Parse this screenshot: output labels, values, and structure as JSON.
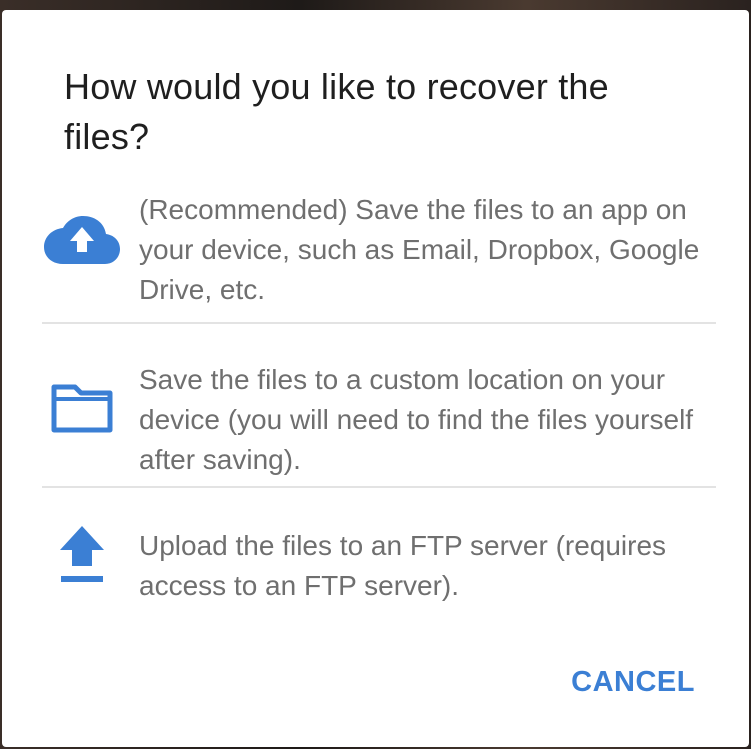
{
  "dialog": {
    "title": "How would you like to recover the files?",
    "options": [
      {
        "icon": "cloud-upload-icon",
        "label": "(Recommended) Save the files to an app on your device, such as Email, Dropbox, Google Drive, etc."
      },
      {
        "icon": "folder-icon",
        "label": "Save the files to a custom location on your device (you will need to find the files yourself after saving)."
      },
      {
        "icon": "upload-icon",
        "label": "Upload the files to an FTP server (requires access to an FTP server)."
      }
    ],
    "cancel_label": "CANCEL",
    "accent_color": "#3b7fd4"
  }
}
